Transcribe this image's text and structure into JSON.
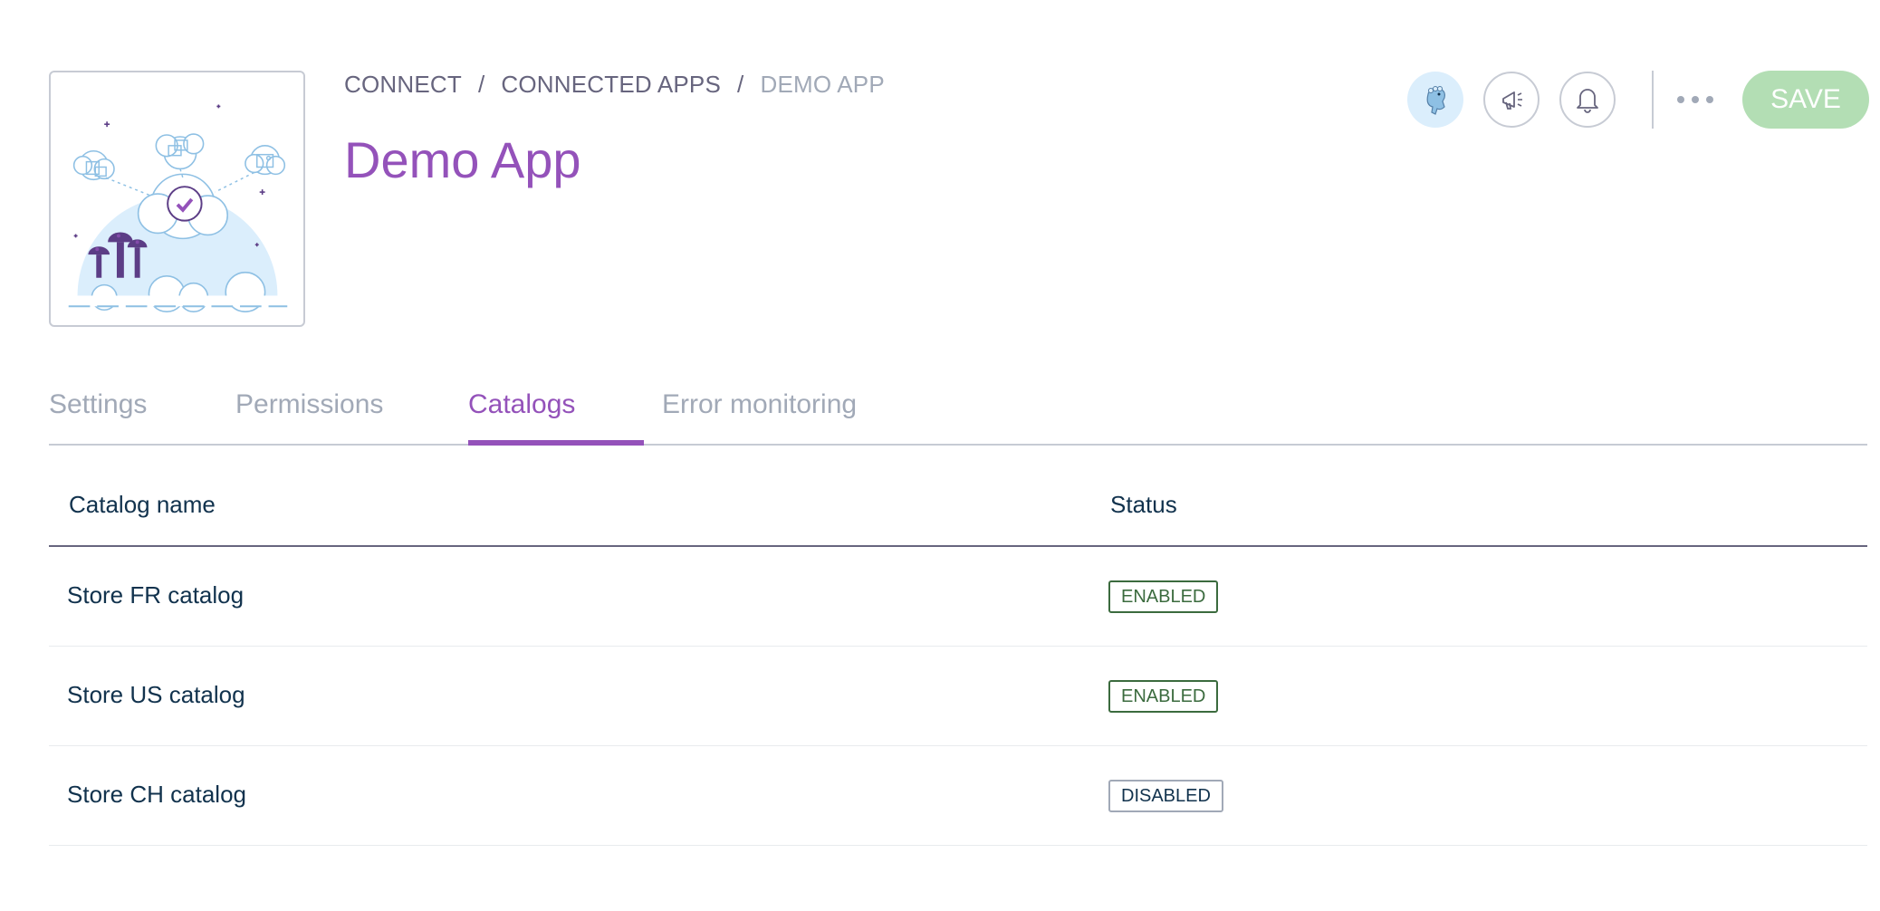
{
  "breadcrumb": {
    "items": [
      "CONNECT",
      "CONNECTED APPS",
      "DEMO APP"
    ],
    "separator": "/"
  },
  "page": {
    "title": "Demo App"
  },
  "header_actions": {
    "icons": [
      "user-avatar-icon",
      "megaphone-icon",
      "bell-icon",
      "more-options-icon"
    ],
    "save_label": "SAVE"
  },
  "tabs": [
    {
      "label": "Settings",
      "active": false
    },
    {
      "label": "Permissions",
      "active": false
    },
    {
      "label": "Catalogs",
      "active": true
    },
    {
      "label": "Error monitoring",
      "active": false
    }
  ],
  "table": {
    "columns": [
      "Catalog name",
      "Status"
    ],
    "rows": [
      {
        "name": "Store FR catalog",
        "status": "ENABLED"
      },
      {
        "name": "Store US catalog",
        "status": "ENABLED"
      },
      {
        "name": "Store CH catalog",
        "status": "DISABLED"
      }
    ]
  },
  "colors": {
    "accent": "#9452ba",
    "enabled": "#3b6b3e",
    "save_button": "#b3deb4",
    "muted": "#a1a9b7"
  }
}
